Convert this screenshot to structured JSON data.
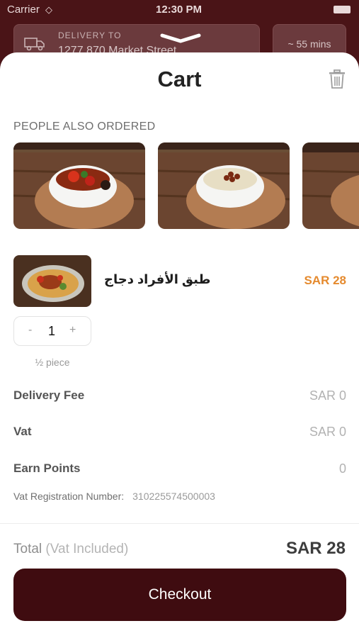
{
  "status_bar": {
    "carrier": "Carrier",
    "time": "12:30 PM"
  },
  "header": {
    "delivery_label": "DELIVERY TO",
    "delivery_address": "1277 870 Market Street",
    "eta": "~ 55 mins"
  },
  "cart": {
    "title": "Cart",
    "recommendations_label": "PEOPLE ALSO ORDERED",
    "recommendations": [
      {
        "icon": "bowl-stew-image"
      },
      {
        "icon": "bowl-rice-image"
      },
      {
        "icon": "bowl-partial-image"
      }
    ],
    "item": {
      "name": "طبق الأفراد دجاج",
      "price": "SAR 28",
      "quantity": "1",
      "minus": "-",
      "plus": "+",
      "portion": "½ piece"
    },
    "summary": {
      "delivery_fee_label": "Delivery Fee",
      "delivery_fee_value": "SAR 0",
      "vat_label": "Vat",
      "vat_value": "SAR 0",
      "points_label": "Earn Points",
      "points_value": "0",
      "vat_reg_label": "Vat Registration Number:",
      "vat_reg_number": "310225574500003"
    },
    "total": {
      "label": "Total",
      "label_note": "(Vat Included)",
      "value": "SAR 28"
    },
    "checkout_label": "Checkout"
  },
  "colors": {
    "brand": "#3f0c10",
    "price_accent": "#e58a2e",
    "background_header": "#4a1417"
  }
}
